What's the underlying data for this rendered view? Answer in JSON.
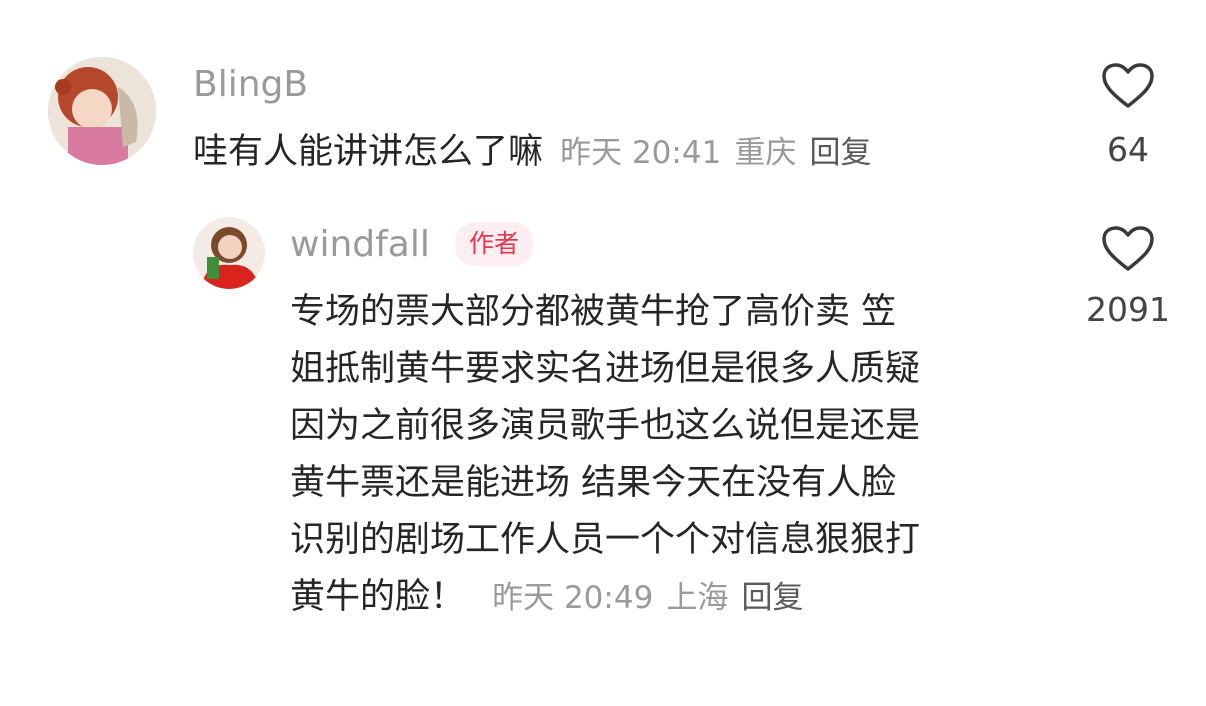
{
  "comments": [
    {
      "username": "BlingB",
      "text": "哇有人能讲讲怎么了嘛",
      "time": "昨天 20:41",
      "location": "重庆",
      "reply_label": "回复",
      "likes": "64"
    }
  ],
  "reply": {
    "username": "windfall",
    "badge": "作者",
    "text_lines": [
      "专场的票大部分都被黄牛抢了高价卖 笠",
      "姐抵制黄牛要求实名进场但是很多人质疑",
      "因为之前很多演员歌手也这么说但是还是",
      "黄牛票还是能进场 结果今天在没有人脸",
      "识别的剧场工作人员一个个对信息狠狠打",
      "黄牛的脸！"
    ],
    "time": "昨天 20:49",
    "location": "上海",
    "reply_label": "回复",
    "likes": "2091"
  },
  "icons": {
    "like": "heart-outline-icon",
    "avatar1": "avatar-icon",
    "avatar2": "avatar-icon"
  },
  "colors": {
    "badge_text": "#e8364f",
    "badge_bg": "#fdeff1",
    "meta": "#9a9a9a"
  }
}
